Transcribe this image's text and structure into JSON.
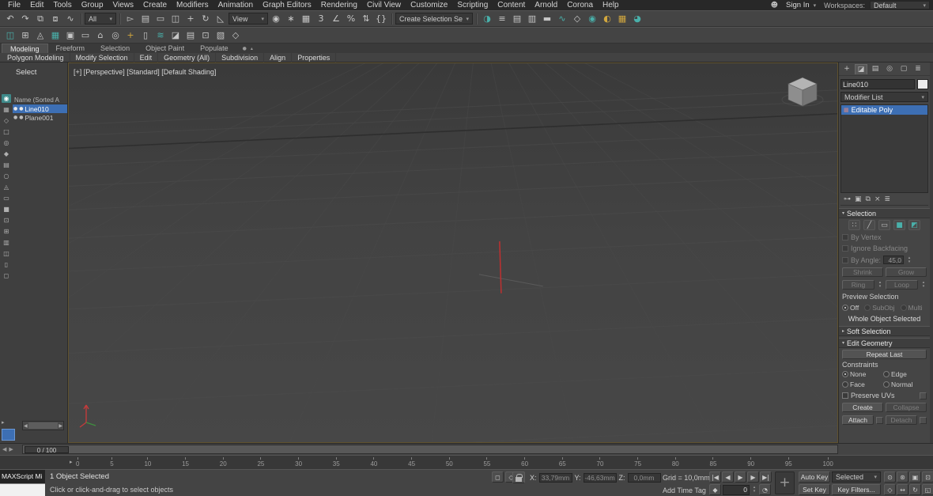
{
  "menubar": {
    "items": [
      "File",
      "Edit",
      "Tools",
      "Group",
      "Views",
      "Create",
      "Modifiers",
      "Animation",
      "Graph Editors",
      "Rendering",
      "Civil View",
      "Customize",
      "Scripting",
      "Content",
      "Arnold",
      "Corona",
      "Help"
    ],
    "user_icon": "☻",
    "sign_in_label": "Sign In",
    "workspaces_label": "Workspaces:",
    "workspace_value": "Default"
  },
  "toolbar": {
    "icons_a": [
      {
        "name": "undo-icon",
        "glyph": "↶"
      },
      {
        "name": "redo-icon",
        "glyph": "↷"
      },
      {
        "name": "select-and-link-icon",
        "glyph": "⧉"
      },
      {
        "name": "unlink-selection-icon",
        "glyph": "⧈"
      },
      {
        "name": "bind-to-space-warp-icon",
        "glyph": "∿"
      }
    ],
    "filter_value": "All",
    "icons_b": [
      {
        "name": "select-object-icon",
        "glyph": "▻"
      },
      {
        "name": "select-by-name-icon",
        "glyph": "▤"
      },
      {
        "name": "rectangular-selection-region-icon",
        "glyph": "▭"
      },
      {
        "name": "window-crossing-icon",
        "glyph": "◫"
      },
      {
        "name": "select-and-move-icon",
        "glyph": "+"
      },
      {
        "name": "select-and-rotate-icon",
        "glyph": "↻"
      },
      {
        "name": "select-and-scale-icon",
        "glyph": "◺"
      }
    ],
    "ref_coord_value": "View",
    "icons_c": [
      {
        "name": "use-pivot-center-icon",
        "glyph": "◉"
      },
      {
        "name": "select-and-manipulate-icon",
        "glyph": "∗"
      },
      {
        "name": "keyboard-override-icon",
        "glyph": "▦"
      },
      {
        "name": "snaps-toggle-icon",
        "glyph": "3"
      },
      {
        "name": "angle-snap-icon",
        "glyph": "∠"
      },
      {
        "name": "percent-snap-icon",
        "glyph": "%"
      },
      {
        "name": "spinner-snap-icon",
        "glyph": "⇅"
      },
      {
        "name": "named-selection-sets-icon",
        "glyph": "{}"
      }
    ],
    "selection_set_value": "Create Selection Se",
    "icons_d": [
      {
        "name": "mirror-icon",
        "glyph": "◑",
        "teal": true
      },
      {
        "name": "align-icon",
        "glyph": "≡"
      },
      {
        "name": "scene-explorer-toggle-icon",
        "glyph": "▤"
      },
      {
        "name": "layer-explorer-toggle-icon",
        "glyph": "▥"
      },
      {
        "name": "ribbon-toggle-icon",
        "glyph": "▬"
      },
      {
        "name": "curve-editor-icon",
        "glyph": "∿",
        "teal": true
      },
      {
        "name": "schematic-view-icon",
        "glyph": "◇"
      },
      {
        "name": "material-editor-icon",
        "glyph": "◉",
        "teal": true
      },
      {
        "name": "render-setup-icon",
        "glyph": "◐",
        "gold": true
      },
      {
        "name": "rendered-frame-icon",
        "glyph": "▦",
        "gold": true
      },
      {
        "name": "render-production-icon",
        "glyph": "◕",
        "teal": true
      }
    ],
    "icons_row2": [
      {
        "name": "toolbar2-icon",
        "glyph": "◫",
        "teal": true
      },
      {
        "name": "toolbar2-icon",
        "glyph": "⊞"
      },
      {
        "name": "toolbar2-icon",
        "glyph": "◬"
      },
      {
        "name": "toolbar2-icon",
        "glyph": "▦",
        "teal": true
      },
      {
        "name": "toolbar2-icon",
        "glyph": "▣"
      },
      {
        "name": "toolbar2-icon",
        "glyph": "▭"
      },
      {
        "name": "toolbar2-icon",
        "glyph": "⌂"
      },
      {
        "name": "toolbar2-icon",
        "glyph": "◎"
      },
      {
        "name": "toolbar2-icon",
        "glyph": "+",
        "gold": true
      },
      {
        "name": "toolbar2-icon",
        "glyph": "▯"
      },
      {
        "name": "toolbar2-icon",
        "glyph": "≋",
        "teal": true
      },
      {
        "name": "toolbar2-icon",
        "glyph": "◪"
      },
      {
        "name": "toolbar2-icon",
        "glyph": "▤"
      },
      {
        "name": "toolbar2-icon",
        "glyph": "⊡"
      },
      {
        "name": "toolbar2-icon",
        "glyph": "▧"
      },
      {
        "name": "toolbar2-icon",
        "glyph": "◇"
      }
    ]
  },
  "ribbon": {
    "tabs": [
      {
        "label": "Modeling",
        "active": true
      },
      {
        "label": "Freeform"
      },
      {
        "label": "Selection"
      },
      {
        "label": "Object Paint"
      },
      {
        "label": "Populate"
      }
    ],
    "extra": [
      {
        "name": "ribbon-config-icon",
        "glyph": "●"
      },
      {
        "name": "minimize-ribbon-icon",
        "glyph": "▴"
      }
    ],
    "subtabs": [
      "Polygon Modeling",
      "Modify Selection",
      "Edit",
      "Geometry (All)",
      "Subdivision",
      "Align",
      "Properties"
    ]
  },
  "explorer": {
    "title": "Select",
    "name_column": "Name (Sorted A",
    "row_icon": "●",
    "toolbar_icons": [
      {
        "glyph": "◉",
        "active": true
      },
      {
        "glyph": "▦"
      },
      {
        "glyph": "◇"
      },
      {
        "glyph": "□"
      },
      {
        "glyph": "◎"
      },
      {
        "glyph": "◆"
      },
      {
        "glyph": "▤"
      },
      {
        "glyph": "○"
      },
      {
        "glyph": "◬"
      },
      {
        "glyph": "▭"
      },
      {
        "glyph": "■"
      },
      {
        "glyph": "⊡"
      },
      {
        "glyph": "⊞"
      },
      {
        "glyph": "▥"
      },
      {
        "glyph": "◫"
      },
      {
        "glyph": "▯"
      },
      {
        "glyph": "◻"
      }
    ],
    "rows": [
      {
        "label": "Line010",
        "selected": true
      },
      {
        "label": "Plane001",
        "selected": false
      }
    ],
    "hscroll_left": "◀",
    "hscroll_right": "▶",
    "layout_arrow": "▸"
  },
  "viewport": {
    "label": "[+] [Perspective] [Standard] [Default Shading]"
  },
  "command_panel": {
    "tabs": [
      {
        "name": "create-tab-icon",
        "glyph": "+"
      },
      {
        "name": "modify-tab-icon",
        "glyph": "◪",
        "active": true
      },
      {
        "name": "hierarchy-tab-icon",
        "glyph": "▤"
      },
      {
        "name": "motion-tab-icon",
        "glyph": "◎"
      },
      {
        "name": "display-tab-icon",
        "glyph": "▢"
      },
      {
        "name": "utilities-tab-icon",
        "glyph": "≣"
      }
    ],
    "object_name": "Line010",
    "modifier_list_label": "Modifier List",
    "stack_icon": "▦",
    "stack": [
      {
        "label": "Editable Poly",
        "selected": true
      }
    ],
    "stack_tools": [
      {
        "name": "pin-stack-icon",
        "glyph": "⊶"
      },
      {
        "name": "show-end-result-icon",
        "glyph": "▣"
      },
      {
        "name": "make-unique-icon",
        "glyph": "⧉"
      },
      {
        "name": "remove-modifier-icon",
        "glyph": "×"
      },
      {
        "name": "configure-modifier-sets-icon",
        "glyph": "≣"
      }
    ],
    "selection": {
      "title": "Selection",
      "subobject_icons": [
        {
          "name": "vertex-subobject-icon",
          "glyph": "∷"
        },
        {
          "name": "edge-subobject-icon",
          "glyph": "╱"
        },
        {
          "name": "border-subobject-icon",
          "glyph": "▭"
        },
        {
          "name": "polygon-subobject-icon",
          "glyph": "■",
          "teal": true
        },
        {
          "name": "element-subobject-icon",
          "glyph": "◩",
          "teal": true
        }
      ],
      "by_vertex_label": "By Vertex",
      "ignore_backfacing_label": "Ignore Backfacing",
      "by_angle_label": "By Angle:",
      "angle_value": "45,0",
      "shrink_label": "Shrink",
      "grow_label": "Grow",
      "ring_label": "Ring",
      "loop_label": "Loop",
      "preview_label": "Preview Selection",
      "preview_options": [
        {
          "label": "Off",
          "on": true
        },
        {
          "label": "SubObj",
          "dim": true
        },
        {
          "label": "Multi",
          "dim": true
        }
      ],
      "whole_object_label": "Whole Object Selected"
    },
    "soft_selection_title": "Soft Selection",
    "soft_selection_collapsed": true,
    "edit_geometry": {
      "title": "Edit Geometry",
      "repeat_last_label": "Repeat Last",
      "constraints_label": "Constraints",
      "constraint_options": [
        {
          "label": "None",
          "on": true
        },
        {
          "label": "Edge"
        },
        {
          "label": "Face"
        },
        {
          "label": "Normal"
        }
      ],
      "preserve_uvs_label": "Preserve UVs",
      "create_label": "Create",
      "collapse_label": "Collapse",
      "attach_label": "Attach",
      "detach_label": "Detach"
    }
  },
  "timeline": {
    "track_label": "0 / 100",
    "nav_icons": [
      {
        "name": "previous-key-icon",
        "glyph": "◀"
      },
      {
        "name": "next-key-icon",
        "glyph": "▶"
      }
    ],
    "arrow_glyph": "▸",
    "ticks": [
      "0",
      "5",
      "10",
      "15",
      "20",
      "25",
      "30",
      "35",
      "40",
      "45",
      "50",
      "55",
      "60",
      "65",
      "70",
      "75",
      "80",
      "85",
      "90",
      "95",
      "100"
    ]
  },
  "status": {
    "maxscript_label": "MAXScript Mi",
    "selection_status": "1 Object Selected",
    "prompt": "Click or click-and-drag to select objects",
    "mid_icons": [
      {
        "name": "isolate-selection-toggle-icon",
        "glyph": "◻"
      },
      {
        "name": "offset-mode-toggle-icon",
        "glyph": "◇"
      }
    ],
    "x_label": "X:",
    "x_value": "33,79mm",
    "y_label": "Y:",
    "y_value": "-46,63mm",
    "z_label": "Z:",
    "z_value": "0,0mm",
    "grid_label": "Grid = 10,0mm",
    "add_time_tag_label": "Add Time Tag",
    "playback_icons": [
      {
        "name": "go-to-start-icon",
        "glyph": "|◀"
      },
      {
        "name": "previous-frame-icon",
        "glyph": "◀"
      },
      {
        "name": "play-icon",
        "glyph": "▶"
      },
      {
        "name": "next-frame-icon",
        "glyph": "▶"
      },
      {
        "name": "go-to-end-icon",
        "glyph": "▶|"
      }
    ],
    "key_mode_glyph": "◆",
    "frame_value": "0",
    "time_config_glyph": "◔",
    "set_keys_glyph": "+",
    "auto_key_label": "Auto Key",
    "selected_set_value": "Selected",
    "set_key_label": "Set Key",
    "key_filters_label": "Key Filters...",
    "nav_row1": [
      {
        "name": "zoom-icon",
        "glyph": "⊙"
      },
      {
        "name": "zoom-all-icon",
        "glyph": "⊛"
      },
      {
        "name": "zoom-extents-icon",
        "glyph": "▣"
      },
      {
        "name": "zoom-extents-all-icon",
        "glyph": "⊡"
      }
    ],
    "nav_row2": [
      {
        "name": "field-of-view-icon",
        "glyph": "◇"
      },
      {
        "name": "pan-icon",
        "glyph": "↔"
      },
      {
        "name": "orbit-icon",
        "glyph": "↻"
      },
      {
        "name": "maximize-viewport-icon",
        "glyph": "◱"
      }
    ]
  },
  "colors": {
    "accent_blue": "#3d6fb4",
    "teal": "#49b0aa",
    "gold": "#d2a73e",
    "viewport_bg": "#414141"
  }
}
